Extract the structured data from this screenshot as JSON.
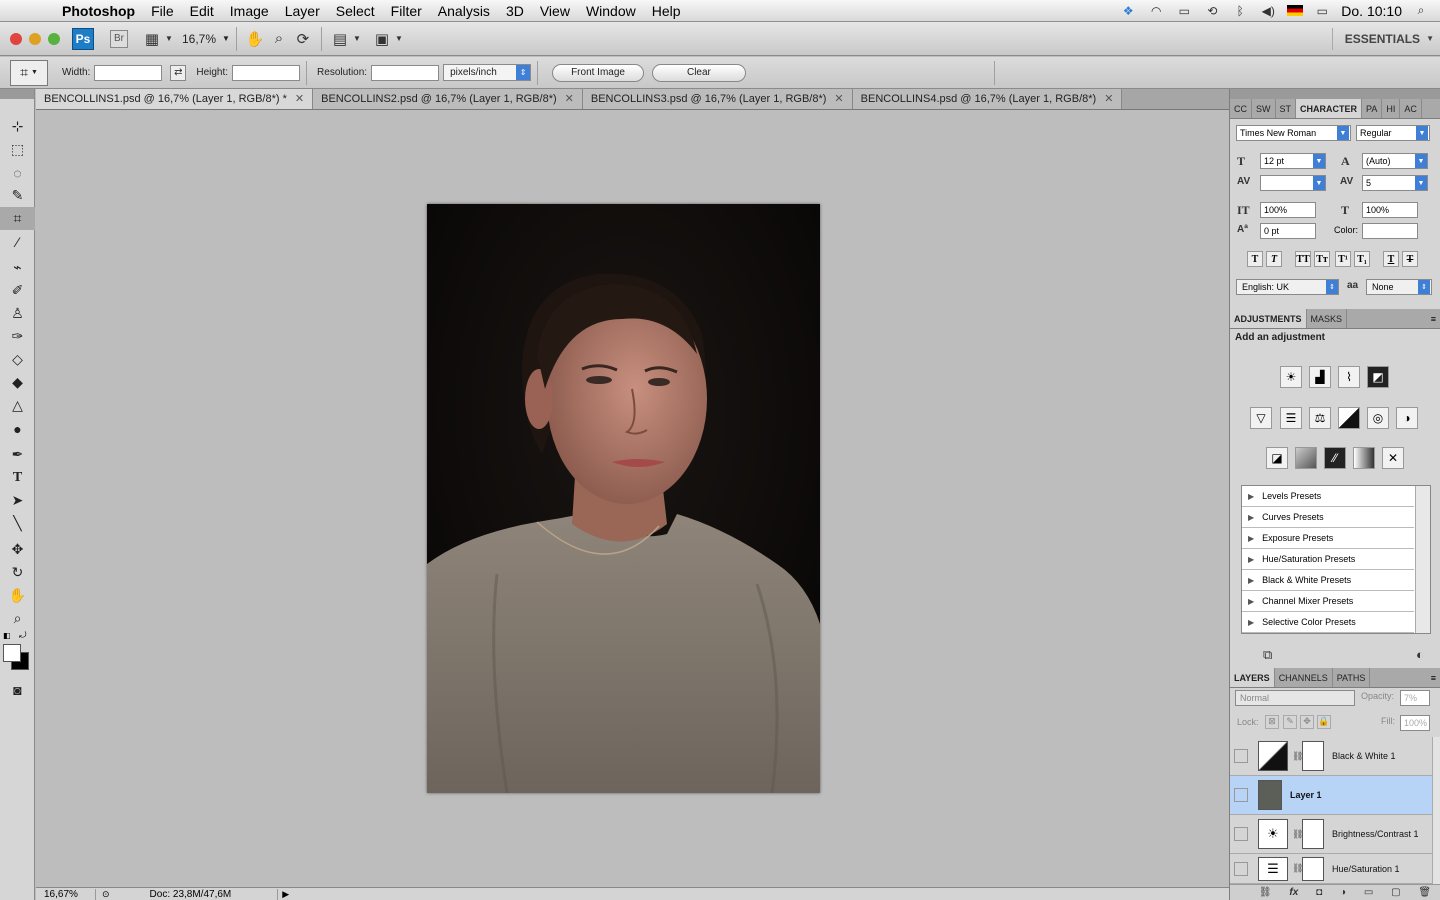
{
  "menubar": {
    "app": "Photoshop",
    "items": [
      "File",
      "Edit",
      "Image",
      "Layer",
      "Select",
      "Filter",
      "Analysis",
      "3D",
      "View",
      "Window",
      "Help"
    ],
    "clock": "Do. 10:10"
  },
  "appbar": {
    "ps_logo": "Ps",
    "br_logo": "Br",
    "zoom": "16,7%",
    "workspace": "ESSENTIALS"
  },
  "options": {
    "width_label": "Width:",
    "height_label": "Height:",
    "resolution_label": "Resolution:",
    "units": "pixels/inch",
    "front_image": "Front Image",
    "clear": "Clear"
  },
  "document_tabs": [
    {
      "label": "BENCOLLINS1.psd @ 16,7% (Layer 1, RGB/8*) *",
      "active": true
    },
    {
      "label": "BENCOLLINS2.psd @ 16,7% (Layer 1, RGB/8*)",
      "active": false
    },
    {
      "label": "BENCOLLINS3.psd @ 16,7% (Layer 1, RGB/8*)",
      "active": false
    },
    {
      "label": "BENCOLLINS4.psd @ 16,7% (Layer 1, RGB/8*)",
      "active": false
    }
  ],
  "status": {
    "zoom": "16,67%",
    "doc": "Doc: 23,8M/47,6M"
  },
  "character_panel": {
    "tabs": [
      "CC",
      "SW",
      "ST",
      "CHARACTER",
      "PA",
      "HI",
      "AC"
    ],
    "font_family": "Times New Roman",
    "font_style": "Regular",
    "size": "12 pt",
    "leading": "(Auto)",
    "kerning": "",
    "tracking": "5",
    "vscale": "100%",
    "hscale": "100%",
    "baseline": "0 pt",
    "color_label": "Color:",
    "language": "English: UK",
    "antialias_icon": "aa",
    "antialias": "None"
  },
  "adjustments_panel": {
    "tabs": [
      "ADJUSTMENTS",
      "MASKS"
    ],
    "title": "Add an adjustment",
    "presets": [
      "Levels Presets",
      "Curves Presets",
      "Exposure Presets",
      "Hue/Saturation Presets",
      "Black & White Presets",
      "Channel Mixer Presets",
      "Selective Color Presets"
    ]
  },
  "layers_panel": {
    "tabs": [
      "LAYERS",
      "CHANNELS",
      "PATHS"
    ],
    "blend_mode": "Normal",
    "opacity_label": "Opacity:",
    "opacity": "7%",
    "lock_label": "Lock:",
    "fill_label": "Fill:",
    "fill": "100%",
    "layers": [
      {
        "name": "Black & White 1",
        "selected": false
      },
      {
        "name": "Layer 1",
        "selected": true
      },
      {
        "name": "Brightness/Contrast 1",
        "selected": false
      },
      {
        "name": "Hue/Saturation 1",
        "selected": false
      }
    ]
  }
}
